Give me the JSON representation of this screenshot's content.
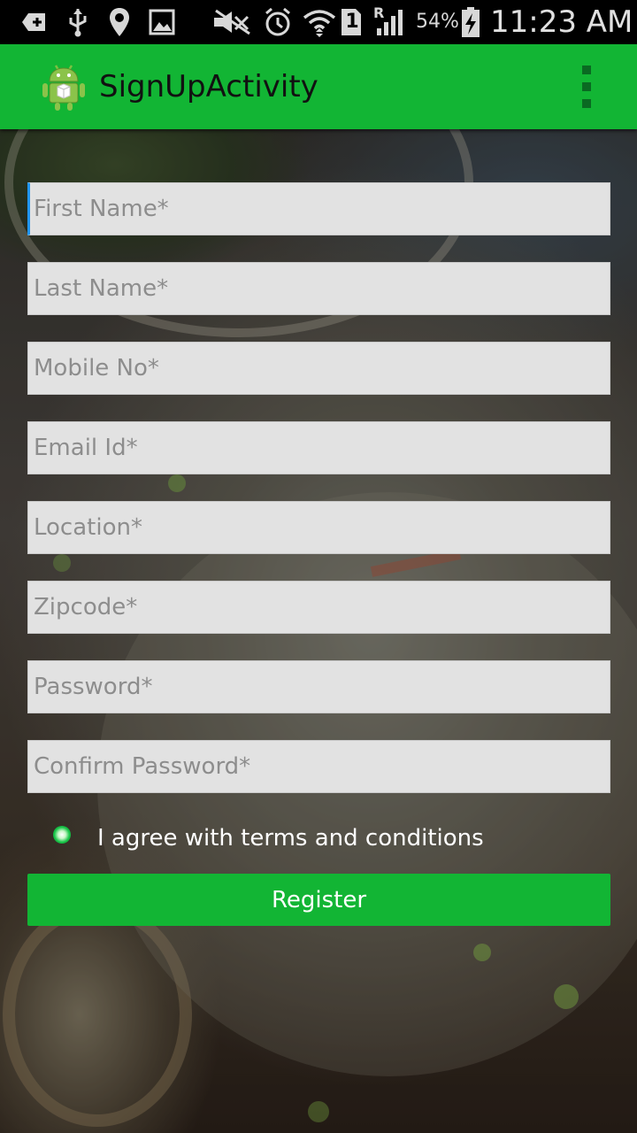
{
  "status_bar": {
    "battery_percent": "54%",
    "time": "11:23 AM",
    "sim_slot": "1",
    "roaming": "R",
    "icons": [
      "add-notification-icon",
      "usb-icon",
      "location-icon",
      "gallery-icon",
      "mute-icon",
      "alarm-icon",
      "wifi-icon",
      "sim-icon",
      "signal-icon",
      "battery-charging-icon"
    ]
  },
  "action_bar": {
    "title": "SignUpActivity",
    "app_icon": "android-icon",
    "menu_icon": "overflow-menu-icon",
    "color": "#12b534"
  },
  "form": {
    "first_name": {
      "placeholder": "First Name*",
      "value": ""
    },
    "last_name": {
      "placeholder": "Last Name*",
      "value": ""
    },
    "mobile": {
      "placeholder": "Mobile No*",
      "value": ""
    },
    "email": {
      "placeholder": "Email Id*",
      "value": ""
    },
    "location": {
      "placeholder": "Location*",
      "value": ""
    },
    "zipcode": {
      "placeholder": "Zipcode*",
      "value": ""
    },
    "password": {
      "placeholder": "Password*",
      "value": ""
    },
    "confirm_password": {
      "placeholder": "Confirm Password*",
      "value": ""
    },
    "terms_label": "I agree with terms and conditions",
    "register_label": "Register"
  }
}
